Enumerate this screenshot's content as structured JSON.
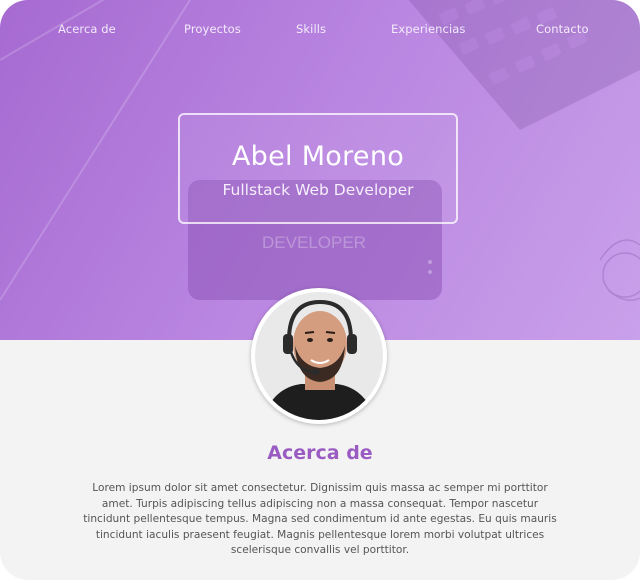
{
  "nav": {
    "items": [
      {
        "label": "Acerca de"
      },
      {
        "label": "Proyectos"
      },
      {
        "label": "Skills"
      },
      {
        "label": "Experiencias"
      },
      {
        "label": "Contacto"
      }
    ]
  },
  "hero": {
    "name": "Abel Moreno",
    "role": "Fullstack Web Developer",
    "background_text": "DEVELOPER"
  },
  "about": {
    "title": "Acerca de",
    "text": "Lorem ipsum dolor sit amet consectetur. Dignissim quis massa ac semper mi porttitor amet. Turpis adipiscing tellus adipiscing non a massa consequat. Tempor nascetur tincidunt pellentesque tempus. Magna sed condimentum id ante egestas. Eu quis mauris tincidunt iaculis praesent feugiat. Magnis pellentesque lorem morbi volutpat ultrices scelerisque convallis vel porttitor."
  },
  "colors": {
    "hero_overlay": "#b27ddc",
    "accent": "#9a5cc2",
    "body_bg": "#f3f3f3",
    "text": "#555555"
  }
}
